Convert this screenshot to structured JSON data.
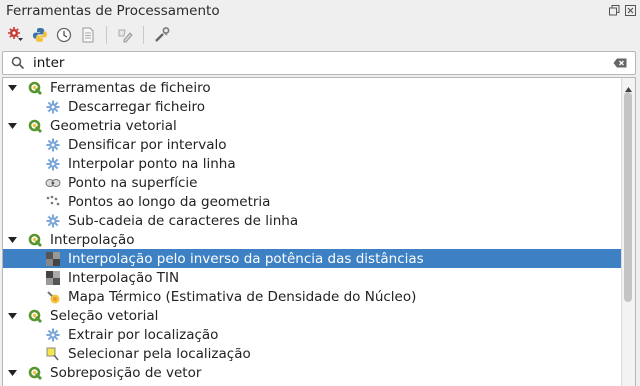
{
  "panel": {
    "title": "Ferramentas de Processamento"
  },
  "toolbar": {
    "buttons": [
      {
        "name": "models-icon"
      },
      {
        "name": "python-icon"
      },
      {
        "name": "history-icon"
      },
      {
        "name": "results-viewer-icon"
      },
      {
        "name": "edit-features-icon"
      },
      {
        "name": "options-icon"
      }
    ]
  },
  "search": {
    "value": "inter"
  },
  "tree": {
    "groups": [
      {
        "label": "Ferramentas de ficheiro"
      },
      {
        "label": "Geometria vetorial"
      },
      {
        "label": "Interpolação"
      },
      {
        "label": "Seleção vetorial"
      },
      {
        "label": "Sobreposição de vetor"
      }
    ],
    "items": [
      {
        "label": "Descarregar ficheiro"
      },
      {
        "label": "Densificar por intervalo"
      },
      {
        "label": "Interpolar ponto na linha"
      },
      {
        "label": "Ponto na superfície"
      },
      {
        "label": "Pontos ao longo da geometria"
      },
      {
        "label": "Sub-cadeia de caracteres de linha"
      },
      {
        "label": "Interpolação pelo inverso da potência das distâncias"
      },
      {
        "label": "Interpolação TIN"
      },
      {
        "label": "Mapa Térmico (Estimativa de Densidade do Núcleo)"
      },
      {
        "label": "Extrair por localização"
      },
      {
        "label": "Selecionar pela localização"
      }
    ],
    "selected_item": "Interpolação pelo inverso da potência das distâncias"
  },
  "colors": {
    "selection": "#3d80c4",
    "qgis_green": "#589632",
    "algorithm_blue": "#7aa6d8"
  }
}
